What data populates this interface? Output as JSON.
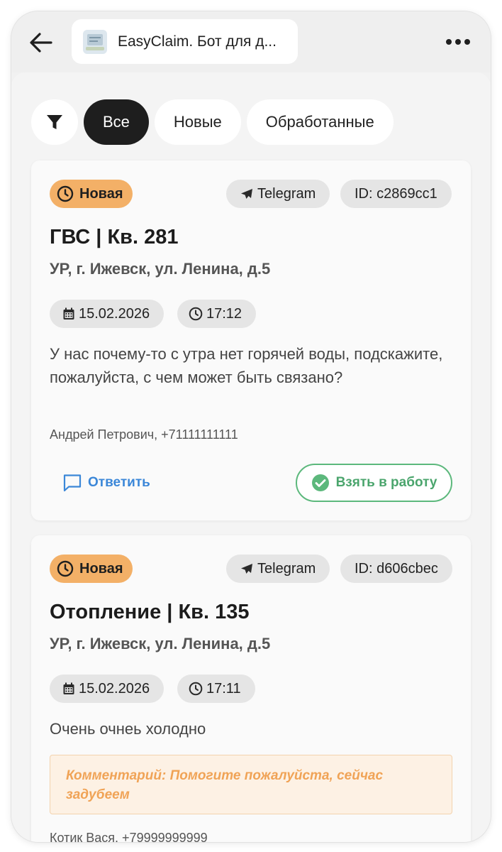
{
  "header": {
    "title": "EasyClaim. Бот для д...",
    "back_icon": "arrow-left-icon",
    "more_icon": "more-horizontal-icon"
  },
  "filters": {
    "filter_icon": "funnel-icon",
    "chips": [
      {
        "label": "Все",
        "active": true
      },
      {
        "label": "Новые",
        "active": false
      },
      {
        "label": "Обработанные",
        "active": false
      }
    ]
  },
  "claims": [
    {
      "status": "Новая",
      "source": "Telegram",
      "id": "ID: c2869cc1",
      "title": "ГВС | Кв. 281",
      "address": "УР, г. Ижевск, ул. Ленина, д.5",
      "date": "15.02.2026",
      "time": "17:12",
      "message": "У нас почему-то с утра нет горячей воды, подскажите, пожалуйста, с чем может быть связано?",
      "author": "Андрей Петрович, +71111111111",
      "reply_label": "Ответить",
      "take_label": "Взять в работу"
    },
    {
      "status": "Новая",
      "source": "Telegram",
      "id": "ID: d606cbec",
      "title": "Отопление | Кв. 135",
      "address": "УР, г. Ижевск, ул. Ленина, д.5",
      "date": "15.02.2026",
      "time": "17:11",
      "message": "Очень очнеь холодно",
      "comment": "Комментарий: Помогите пожалуйста, сейчас задубеем",
      "author": "Котик Вася, +79999999999"
    }
  ],
  "colors": {
    "status_new": "#f3b067",
    "accent_blue": "#3b87d8",
    "accent_green": "#5cb87c",
    "comment_text": "#f0a356",
    "active_chip": "#1e1e1e"
  }
}
